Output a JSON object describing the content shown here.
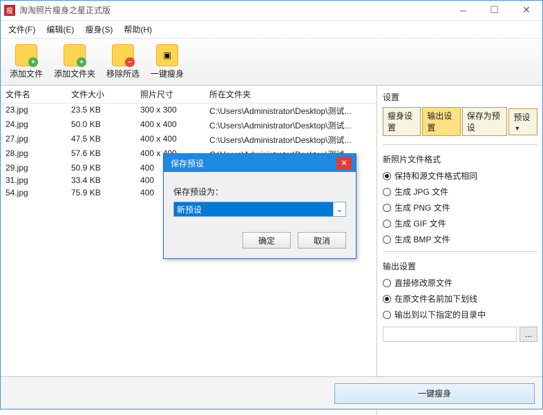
{
  "window": {
    "title": "淘淘照片瘦身之星正式版"
  },
  "menu": {
    "file": "文件(F)",
    "edit": "编辑(E)",
    "slim": "瘦身(S)",
    "help": "帮助(H)"
  },
  "toolbar": {
    "add_file": "添加文件",
    "add_folder": "添加文件夹",
    "remove_selected": "移除所选",
    "one_key": "一键瘦身"
  },
  "columns": {
    "name": "文件名",
    "size": "文件大小",
    "dim": "照片尺寸",
    "folder": "所在文件夹"
  },
  "rows": [
    {
      "name": "23.jpg",
      "size": "23.5 KB",
      "dim": "300 x 300",
      "folder": "C:\\Users\\Administrator\\Desktop\\测试..."
    },
    {
      "name": "24.jpg",
      "size": "50.0 KB",
      "dim": "400 x 400",
      "folder": "C:\\Users\\Administrator\\Desktop\\测试..."
    },
    {
      "name": "27.jpg",
      "size": "47.5 KB",
      "dim": "400 x 400",
      "folder": "C:\\Users\\Administrator\\Desktop\\测试..."
    },
    {
      "name": "28.jpg",
      "size": "57.6 KB",
      "dim": "400 x 400",
      "folder": "C:\\Users\\Administrator\\Desktop\\测试..."
    },
    {
      "name": "29.jpg",
      "size": "50.9 KB",
      "dim": "400",
      "folder": ""
    },
    {
      "name": "31.jpg",
      "size": "33.4 KB",
      "dim": "400",
      "folder": ""
    },
    {
      "name": "54.jpg",
      "size": "75.9 KB",
      "dim": "400",
      "folder": ""
    }
  ],
  "settings": {
    "title": "设置",
    "tabs": {
      "slim": "瘦身设置",
      "output": "输出设置",
      "save_preset": "保存为预设",
      "preset": "预设"
    },
    "format_group": "新照片文件格式",
    "formats": {
      "same": "保持和源文件格式相同",
      "jpg": "生成 JPG 文件",
      "png": "生成 PNG 文件",
      "gif": "生成 GIF 文件",
      "bmp": "生成 BMP 文件"
    },
    "output_group": "输出设置",
    "outputs": {
      "overwrite": "直接修改原文件",
      "prefix": "在原文件名前加下划线",
      "todir": "输出到以下指定的目录中"
    },
    "browse": "..."
  },
  "modal": {
    "title": "保存预设",
    "label": "保存预设为：",
    "value": "新预设",
    "ok": "确定",
    "cancel": "取消"
  },
  "footer": {
    "action": "一键瘦身"
  }
}
